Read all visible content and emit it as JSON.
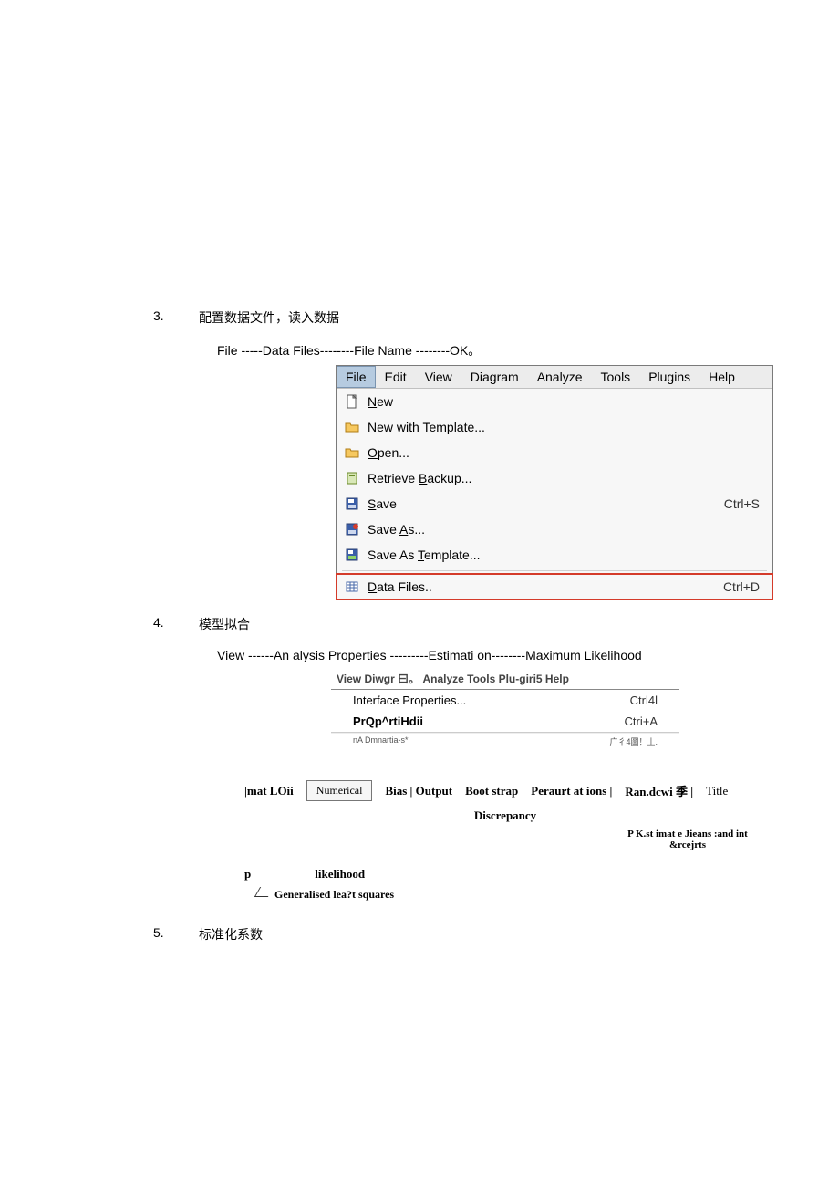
{
  "steps": {
    "s3": {
      "num": "3.",
      "title": "配置数据文件，读入数据",
      "path": "File -----Data Files--------File Name --------OK。"
    },
    "s4": {
      "num": "4.",
      "title": "模型拟合",
      "path": "View ------An alysis Properties ---------Estimati on--------Maximum Likelihood"
    },
    "s5": {
      "num": "5.",
      "title": "标准化系数"
    }
  },
  "menubar": [
    "File",
    "Edit",
    "View",
    "Diagram",
    "Analyze",
    "Tools",
    "Plugins",
    "Help"
  ],
  "filemenu": {
    "new": "New",
    "nwt": "New with Template...",
    "open": "Open...",
    "rbk": "Retrieve Backup...",
    "save": "Save",
    "save_s": "Ctrl+S",
    "saveas": "Save As...",
    "savetpl": "Save As Template...",
    "df": "Data Files..",
    "df_s": "Ctrl+D"
  },
  "viewmenu": {
    "bar": "View Diwgr 曰。        Analyze Tools Plu-giri5 Help",
    "r1": {
      "l": "Interface Properties...",
      "s": "Ctrl4l"
    },
    "r2": {
      "l": "PrQp^rtiHdii",
      "s": "Ctri+A"
    },
    "r3": {
      "l": "nA          Dmnartia-s*",
      "s": "广彳4圖！丄."
    }
  },
  "tabs": {
    "lead": "|mat LOii",
    "t1": "Numerical",
    "t2": "Bias | Output",
    "t3": "Boot strap",
    "t4": "Peraurt at ions |",
    "t5": "Ran.dcwi 季 |",
    "t6": "Title",
    "disc": "Discrepancy",
    "note": "P K.st imat e Jieans :and int &rcejrts",
    "p": "p",
    "lik": "likelihood",
    "gen": "Generalised lea?t squares"
  }
}
